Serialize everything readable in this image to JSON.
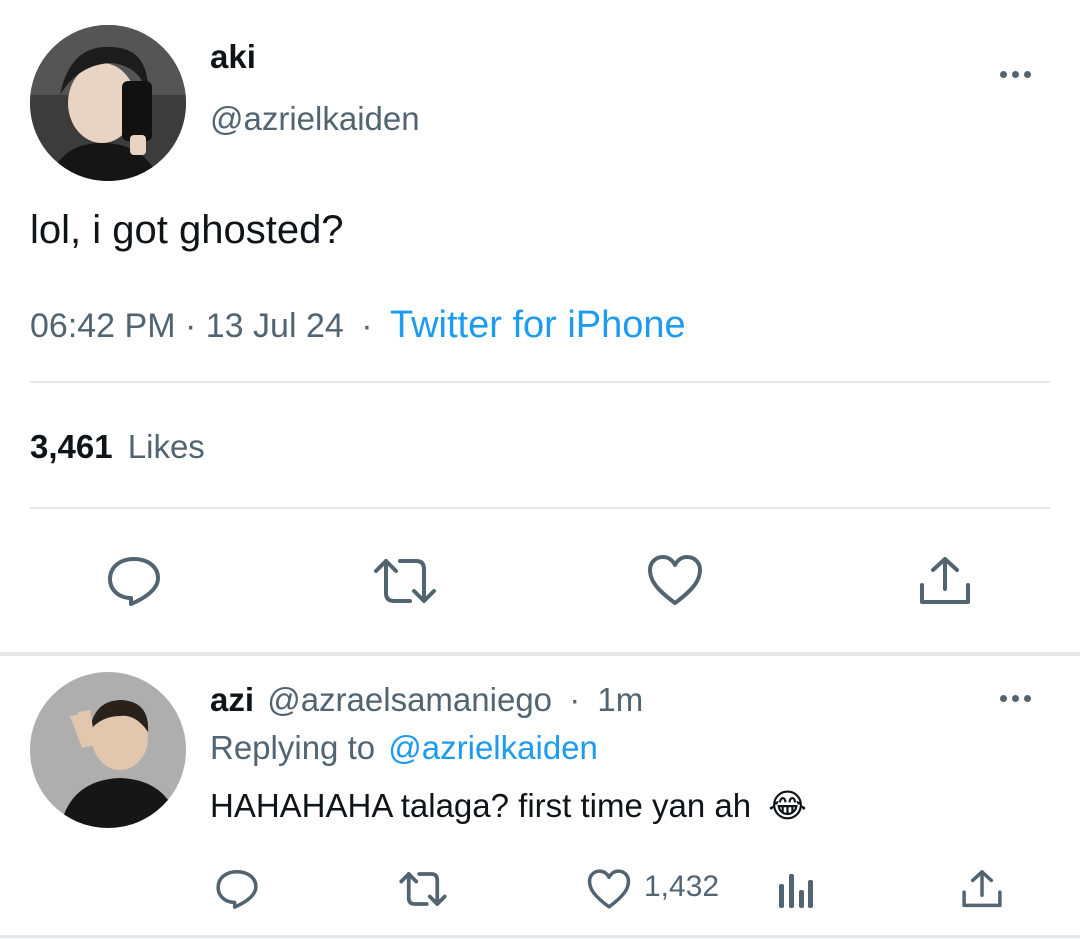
{
  "main_tweet": {
    "display_name": "aki",
    "handle": "@azrielkaiden",
    "text": "lol, i got ghosted?",
    "time": "06:42 PM",
    "date": "13 Jul 24",
    "separator": "·",
    "source": "Twitter for iPhone",
    "likes_count": "3,461",
    "likes_label": "Likes"
  },
  "reply": {
    "display_name": "azi",
    "handle": "@azraelsamaniego",
    "dot": "·",
    "time_ago": "1m",
    "replying_prefix": "Replying to",
    "replying_handle": "@azrielkaiden",
    "text": "HAHAHAHA talaga? first time yan ah",
    "emoji": "😂",
    "like_count": "1,432"
  },
  "colors": {
    "accent": "#1d9bf0",
    "muted": "#536471",
    "text": "#0f1419",
    "divider": "#e6e9eb"
  },
  "icons": [
    "more-icon",
    "reply-icon",
    "retweet-icon",
    "like-icon",
    "share-icon",
    "analytics-icon"
  ]
}
